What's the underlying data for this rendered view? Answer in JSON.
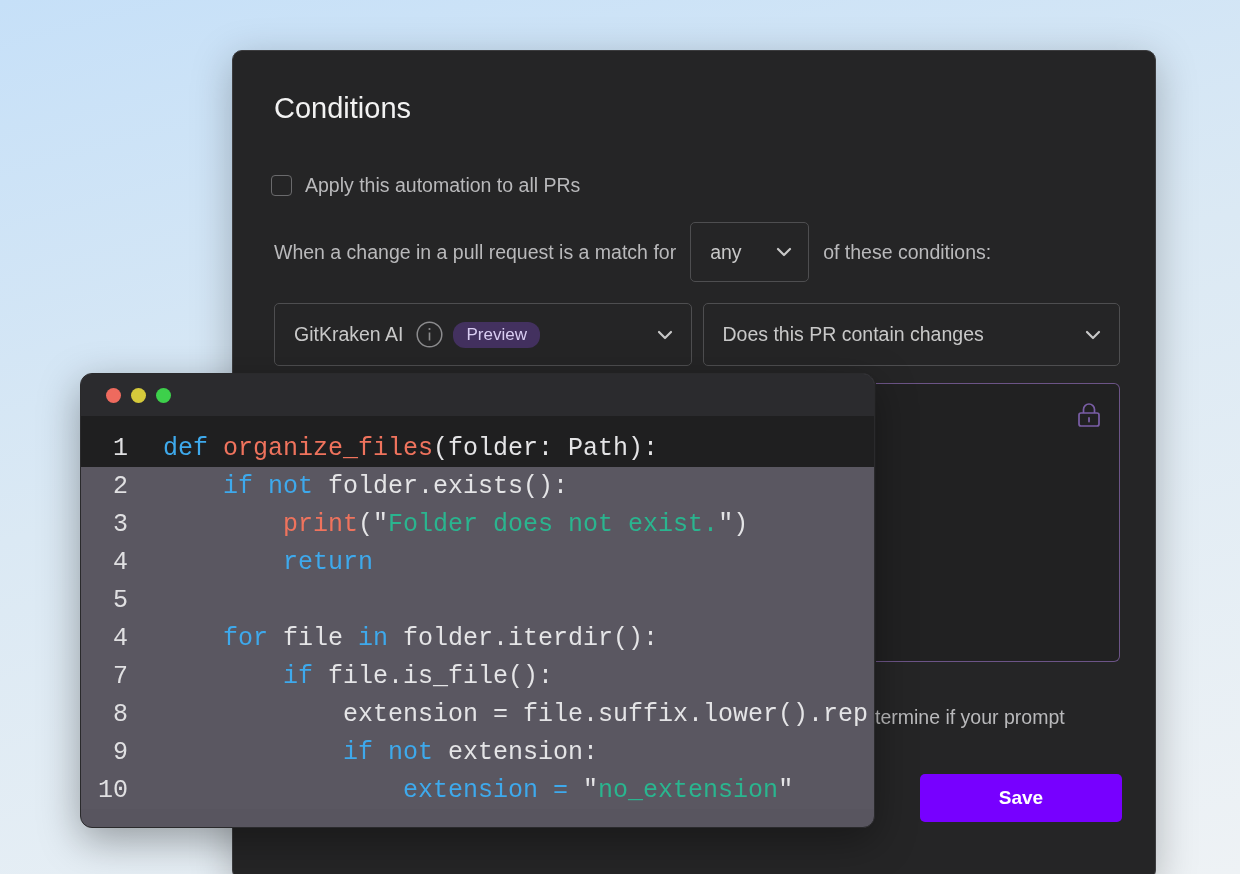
{
  "title": "Conditions",
  "apply_all": {
    "label": "Apply this automation to all PRs",
    "checked": false
  },
  "match_row": {
    "before": "When a change in a pull request is a match for",
    "select_value": "any",
    "after": "of these conditions:"
  },
  "condition": {
    "provider": "GitKraken AI",
    "badge": "Preview",
    "question": "Does this PR contain changes"
  },
  "hint": "termine if your prompt",
  "save_button": "Save",
  "code_window": {
    "lines": [
      {
        "number": "1",
        "highlighted": true,
        "tokens": [
          {
            "kind": "keyword",
            "text": "def"
          },
          {
            "kind": "function",
            "text": " organize_files"
          },
          {
            "kind": "plain",
            "text": "(folder: Path):"
          }
        ]
      },
      {
        "number": "2",
        "highlighted": false,
        "tokens": [
          {
            "kind": "keyword",
            "text": "    if not"
          },
          {
            "kind": "plain",
            "text": " folder.exists():"
          }
        ]
      },
      {
        "number": "3",
        "highlighted": false,
        "tokens": [
          {
            "kind": "function",
            "text": "        print"
          },
          {
            "kind": "plain",
            "text": "(\""
          },
          {
            "kind": "string",
            "text": "Folder does not exist."
          },
          {
            "kind": "plain",
            "text": "\")"
          }
        ]
      },
      {
        "number": "4",
        "highlighted": false,
        "tokens": [
          {
            "kind": "keyword",
            "text": "        return"
          }
        ]
      },
      {
        "number": "5",
        "highlighted": false
      },
      {
        "number": "4",
        "highlighted": false,
        "tokens": [
          {
            "kind": "keyword",
            "text": "    for"
          },
          {
            "kind": "plain",
            "text": " file "
          },
          {
            "kind": "keyword",
            "text": "in"
          },
          {
            "kind": "plain",
            "text": " folder.iterdir():"
          }
        ]
      },
      {
        "number": "7",
        "highlighted": false,
        "tokens": [
          {
            "kind": "keyword",
            "text": "        if"
          },
          {
            "kind": "plain",
            "text": " file.is_file():"
          }
        ]
      },
      {
        "number": "8",
        "highlighted": false,
        "tokens": [
          {
            "kind": "plain",
            "text": "            extension = file.suffix.lower().rep"
          }
        ]
      },
      {
        "number": "9",
        "highlighted": false,
        "tokens": [
          {
            "kind": "keyword",
            "text": "            if not"
          },
          {
            "kind": "plain",
            "text": " extension:"
          }
        ]
      },
      {
        "number": "10",
        "highlighted": false,
        "tokens": [
          {
            "kind": "keyword",
            "text": "                extension ="
          },
          {
            "kind": "plain",
            "text": " \""
          },
          {
            "kind": "string",
            "text": "no_extension"
          },
          {
            "kind": "plain",
            "text": "\""
          }
        ]
      }
    ]
  }
}
